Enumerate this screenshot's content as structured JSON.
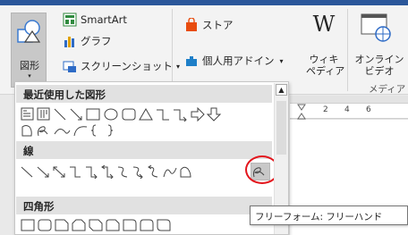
{
  "ribbon": {
    "shapes_label": "図形",
    "smartart_label": "SmartArt",
    "graph_label": "グラフ",
    "screenshot_label": "スクリーンショット",
    "store_label": "ストア",
    "addins_label": "個人用アドイン",
    "wiki_label_line1": "ウィキ",
    "wiki_label_line2": "ペディア",
    "online_video_line1": "オンライン",
    "online_video_line2": "ビデオ",
    "media_group_label": "メディア",
    "wiki_glyph": "W",
    "dropdown_caret": "▾"
  },
  "panel": {
    "recent_header": "最近使用した図形",
    "lines_header": "線",
    "rectangles_header": "四角形"
  },
  "ruler": {
    "marks": [
      "2",
      "4",
      "6"
    ]
  },
  "tooltip": {
    "text": "フリーフォーム: フリーハンド"
  },
  "colors": {
    "accent": "#2b579a",
    "highlight_ring": "#e3161d",
    "store_bag": "#e84c0e",
    "addins_icon": "#1e7fc8"
  }
}
